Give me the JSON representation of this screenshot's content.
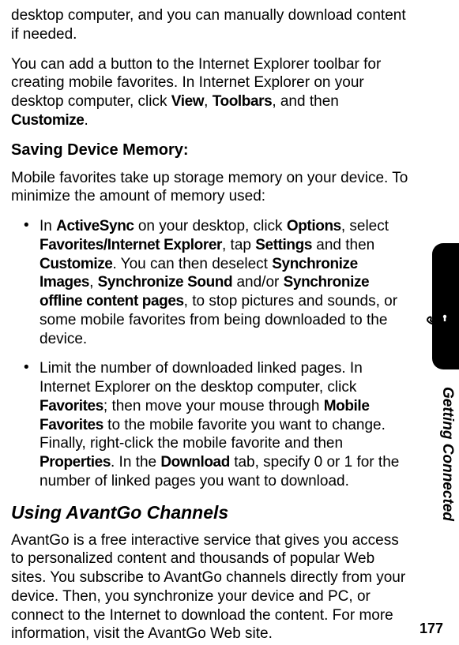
{
  "para1": "desktop computer, and you can manually download content if needed.",
  "para2_pre": "You can add a button to the Internet Explorer toolbar for creating mobile favorites. In Internet Explorer on your desktop computer, click ",
  "para2_view": "View",
  "para2_sep1": ", ",
  "para2_toolbars": "Toolbars",
  "para2_sep2": ", and then ",
  "para2_customize": "Customize",
  "para2_end": ".",
  "heading1": "Saving Device Memory:",
  "para3": "Mobile favorites take up storage memory on your device. To minimize the amount of memory used:",
  "bullet1_t1": "In ",
  "bullet1_activesync": "ActiveSync",
  "bullet1_t2": " on your desktop, click ",
  "bullet1_options": "Options",
  "bullet1_t3": ", select ",
  "bullet1_favie": "Favorites/Internet Explorer",
  "bullet1_t4": ", tap ",
  "bullet1_settings": "Settings",
  "bullet1_t5": " and then ",
  "bullet1_customize": "Customize",
  "bullet1_t6": ". You can then deselect ",
  "bullet1_syncimg": "Synchronize Images",
  "bullet1_t7": ", ",
  "bullet1_syncsnd": "Synchronize Sound",
  "bullet1_t8": " and/or ",
  "bullet1_syncoff": "Synchronize offline content pages",
  "bullet1_t9": ", to stop pictures and sounds, or some mobile favorites from being downloaded to the device.",
  "bullet2_t1": "Limit the number of downloaded linked pages. In Internet Explorer on the desktop computer, click ",
  "bullet2_favorites": "Favorites",
  "bullet2_t2": "; then move your mouse through ",
  "bullet2_mobilefav": "Mobile Favorites",
  "bullet2_t3": " to the mobile favorite you want to change. Finally, right-click the mobile favorite and then ",
  "bullet2_properties": "Properties",
  "bullet2_t4": ". In the ",
  "bullet2_download": "Download",
  "bullet2_t5": " tab, specify 0 or 1 for the number of linked pages you want to download.",
  "section_heading": "Using AvantGo Channels",
  "para4": "AvantGo is a free interactive service that gives you access to personalized content and thousands of popular Web sites. You subscribe to AvantGo channels directly from your device. Then, you synchronize your device and PC, or connect to the Internet to download the content. For more information, visit the AvantGo Web site.",
  "side_label": "Getting Connected",
  "page_number": "177"
}
